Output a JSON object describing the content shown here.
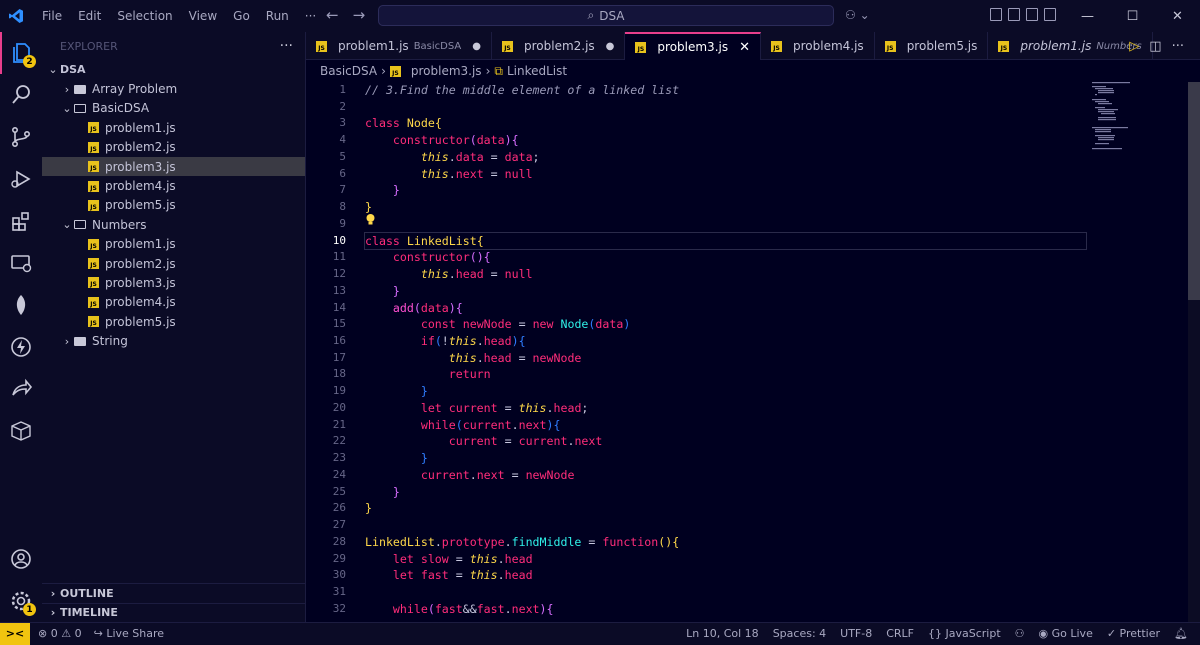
{
  "menu": [
    "File",
    "Edit",
    "Selection",
    "View",
    "Go",
    "Run",
    "···"
  ],
  "search": {
    "label": "DSA"
  },
  "activity": {
    "explorer_badge": "2",
    "settings_badge": "1"
  },
  "sidebar": {
    "header": "EXPLORER",
    "root": "DSA",
    "items": [
      {
        "type": "folder",
        "label": "Array Problem",
        "depth": 1,
        "open": false
      },
      {
        "type": "folder",
        "label": "BasicDSA",
        "depth": 1,
        "open": true
      },
      {
        "type": "file",
        "label": "problem1.js",
        "depth": 2
      },
      {
        "type": "file",
        "label": "problem2.js",
        "depth": 2
      },
      {
        "type": "file",
        "label": "problem3.js",
        "depth": 2,
        "selected": true
      },
      {
        "type": "file",
        "label": "problem4.js",
        "depth": 2
      },
      {
        "type": "file",
        "label": "problem5.js",
        "depth": 2
      },
      {
        "type": "folder",
        "label": "Numbers",
        "depth": 1,
        "open": true
      },
      {
        "type": "file",
        "label": "problem1.js",
        "depth": 2
      },
      {
        "type": "file",
        "label": "problem2.js",
        "depth": 2
      },
      {
        "type": "file",
        "label": "problem3.js",
        "depth": 2
      },
      {
        "type": "file",
        "label": "problem4.js",
        "depth": 2
      },
      {
        "type": "file",
        "label": "problem5.js",
        "depth": 2
      },
      {
        "type": "folder",
        "label": "String",
        "depth": 1,
        "open": false
      }
    ],
    "outline": "OUTLINE",
    "timeline": "TIMELINE"
  },
  "tabs": [
    {
      "label": "problem1.js",
      "desc": "BasicDSA",
      "modified": true
    },
    {
      "label": "problem2.js",
      "desc": "",
      "modified": true
    },
    {
      "label": "problem3.js",
      "desc": "",
      "active": true
    },
    {
      "label": "problem4.js",
      "desc": ""
    },
    {
      "label": "problem5.js",
      "desc": ""
    },
    {
      "label": "problem1.js",
      "desc": "Numbers",
      "italic": true
    }
  ],
  "breadcrumb": {
    "folder": "BasicDSA",
    "file": "problem3.js",
    "symbol": "LinkedList"
  },
  "editor": {
    "current_line": 10,
    "lines": [
      [
        [
          "cm",
          "// 3.Find the middle element of a linked list"
        ]
      ],
      [],
      [
        [
          "k",
          "class "
        ],
        [
          "cls",
          "Node"
        ],
        [
          "br1",
          "{"
        ]
      ],
      [
        [
          "t",
          "    "
        ],
        [
          "k",
          "constructor"
        ],
        [
          "br2",
          "("
        ],
        [
          "k",
          "data"
        ],
        [
          "br2",
          ")"
        ],
        [
          "br2",
          "{"
        ]
      ],
      [
        [
          "t",
          "        "
        ],
        [
          "vr",
          "this"
        ],
        [
          "op",
          "."
        ],
        [
          "k",
          "data"
        ],
        [
          "op",
          " = "
        ],
        [
          "k",
          "data"
        ],
        [
          "op",
          ";"
        ]
      ],
      [
        [
          "t",
          "        "
        ],
        [
          "vr",
          "this"
        ],
        [
          "op",
          "."
        ],
        [
          "k",
          "next"
        ],
        [
          "op",
          " = "
        ],
        [
          "k",
          "null"
        ]
      ],
      [
        [
          "t",
          "    "
        ],
        [
          "br2",
          "}"
        ]
      ],
      [
        [
          "br1",
          "}"
        ]
      ],
      [],
      [
        [
          "k",
          "class "
        ],
        [
          "cls",
          "LinkedList"
        ],
        [
          "br1",
          "{"
        ]
      ],
      [
        [
          "t",
          "    "
        ],
        [
          "k",
          "constructor"
        ],
        [
          "br2",
          "("
        ],
        [
          "br2",
          ")"
        ],
        [
          "br2",
          "{"
        ]
      ],
      [
        [
          "t",
          "        "
        ],
        [
          "vr",
          "this"
        ],
        [
          "op",
          "."
        ],
        [
          "k",
          "head"
        ],
        [
          "op",
          " = "
        ],
        [
          "k",
          "null"
        ]
      ],
      [
        [
          "t",
          "    "
        ],
        [
          "br2",
          "}"
        ]
      ],
      [
        [
          "t",
          "    "
        ],
        [
          "fn",
          "add"
        ],
        [
          "br2",
          "("
        ],
        [
          "k",
          "data"
        ],
        [
          "br2",
          ")"
        ],
        [
          "br2",
          "{"
        ]
      ],
      [
        [
          "t",
          "        "
        ],
        [
          "k",
          "const "
        ],
        [
          "k",
          "newNode"
        ],
        [
          "op",
          " = "
        ],
        [
          "k",
          "new "
        ],
        [
          "nm",
          "Node"
        ],
        [
          "br3",
          "("
        ],
        [
          "k",
          "data"
        ],
        [
          "br3",
          ")"
        ]
      ],
      [
        [
          "t",
          "        "
        ],
        [
          "k",
          "if"
        ],
        [
          "br3",
          "("
        ],
        [
          "op",
          "!"
        ],
        [
          "vr",
          "this"
        ],
        [
          "op",
          "."
        ],
        [
          "k",
          "head"
        ],
        [
          "br3",
          ")"
        ],
        [
          "br3",
          "{"
        ]
      ],
      [
        [
          "t",
          "            "
        ],
        [
          "vr",
          "this"
        ],
        [
          "op",
          "."
        ],
        [
          "k",
          "head"
        ],
        [
          "op",
          " = "
        ],
        [
          "k",
          "newNode"
        ]
      ],
      [
        [
          "t",
          "            "
        ],
        [
          "k",
          "return"
        ]
      ],
      [
        [
          "t",
          "        "
        ],
        [
          "br3",
          "}"
        ]
      ],
      [
        [
          "t",
          "        "
        ],
        [
          "k",
          "let "
        ],
        [
          "k",
          "current"
        ],
        [
          "op",
          " = "
        ],
        [
          "vr",
          "this"
        ],
        [
          "op",
          "."
        ],
        [
          "k",
          "head"
        ],
        [
          "op",
          ";"
        ]
      ],
      [
        [
          "t",
          "        "
        ],
        [
          "k",
          "while"
        ],
        [
          "br3",
          "("
        ],
        [
          "k",
          "current"
        ],
        [
          "op",
          "."
        ],
        [
          "k",
          "next"
        ],
        [
          "br3",
          ")"
        ],
        [
          "br3",
          "{"
        ]
      ],
      [
        [
          "t",
          "            "
        ],
        [
          "k",
          "current"
        ],
        [
          "op",
          " = "
        ],
        [
          "k",
          "current"
        ],
        [
          "op",
          "."
        ],
        [
          "k",
          "next"
        ]
      ],
      [
        [
          "t",
          "        "
        ],
        [
          "br3",
          "}"
        ]
      ],
      [
        [
          "t",
          "        "
        ],
        [
          "k",
          "current"
        ],
        [
          "op",
          "."
        ],
        [
          "k",
          "next"
        ],
        [
          "op",
          " = "
        ],
        [
          "k",
          "newNode"
        ]
      ],
      [
        [
          "t",
          "    "
        ],
        [
          "br2",
          "}"
        ]
      ],
      [
        [
          "br1",
          "}"
        ]
      ],
      [],
      [
        [
          "cls",
          "LinkedList"
        ],
        [
          "op",
          "."
        ],
        [
          "k",
          "prototype"
        ],
        [
          "op",
          "."
        ],
        [
          "nm",
          "findMiddle"
        ],
        [
          "op",
          " = "
        ],
        [
          "k",
          "function"
        ],
        [
          "br1",
          "("
        ],
        [
          "br1",
          ")"
        ],
        [
          "br1",
          "{"
        ]
      ],
      [
        [
          "t",
          "    "
        ],
        [
          "k",
          "let "
        ],
        [
          "k",
          "slow"
        ],
        [
          "op",
          " = "
        ],
        [
          "vr",
          "this"
        ],
        [
          "op",
          "."
        ],
        [
          "k",
          "head"
        ]
      ],
      [
        [
          "t",
          "    "
        ],
        [
          "k",
          "let "
        ],
        [
          "k",
          "fast"
        ],
        [
          "op",
          " = "
        ],
        [
          "vr",
          "this"
        ],
        [
          "op",
          "."
        ],
        [
          "k",
          "head"
        ]
      ],
      [],
      [
        [
          "t",
          "    "
        ],
        [
          "k",
          "while"
        ],
        [
          "br2",
          "("
        ],
        [
          "k",
          "fast"
        ],
        [
          "op",
          "&&"
        ],
        [
          "k",
          "fast"
        ],
        [
          "op",
          "."
        ],
        [
          "k",
          "next"
        ],
        [
          "br2",
          ")"
        ],
        [
          "br2",
          "{"
        ]
      ]
    ]
  },
  "status": {
    "remote": "><",
    "errors": "0",
    "warnings": "0",
    "liveshare": "Live Share",
    "position": "Ln 10, Col 18",
    "spaces": "Spaces: 4",
    "encoding": "UTF-8",
    "eol": "CRLF",
    "language": "{} JavaScript",
    "golive": "Go Live",
    "prettier": "✓ Prettier"
  }
}
